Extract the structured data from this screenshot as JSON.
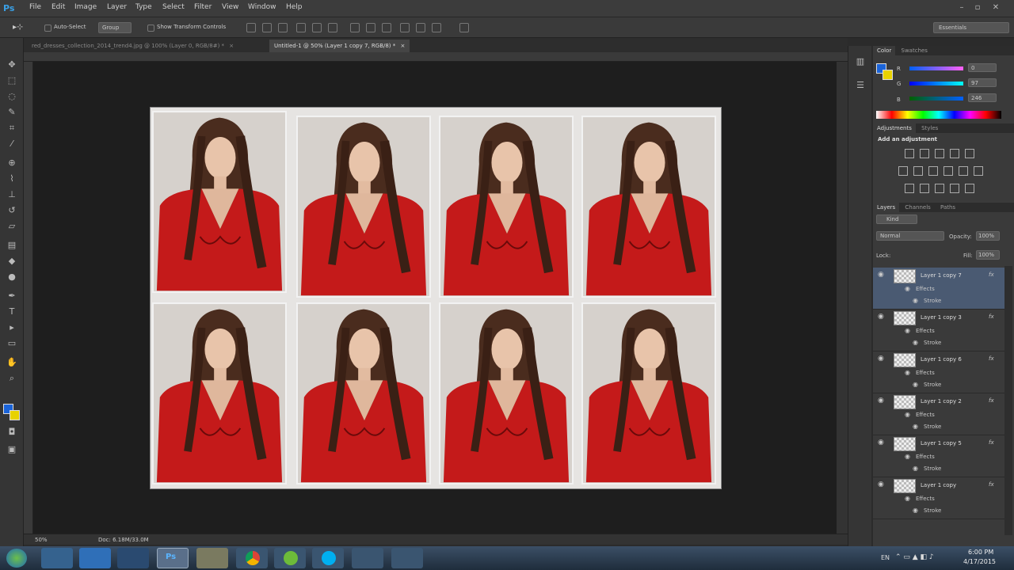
{
  "app": {
    "logo": "Ps"
  },
  "menu": [
    "File",
    "Edit",
    "Image",
    "Layer",
    "Type",
    "Select",
    "Filter",
    "View",
    "Window",
    "Help"
  ],
  "options": {
    "auto_select": "Auto-Select",
    "group": "Group",
    "show_transform": "Show Transform Controls",
    "workspace": "Essentials"
  },
  "tabs": [
    {
      "label": "red_dresses_collection_2014_trend4.jpg @ 100% (Layer 0, RGB/8#) *"
    },
    {
      "label": "Untitled-1 @ 50% (Layer 1 copy 7, RGB/8) *"
    }
  ],
  "status": {
    "zoom": "50%",
    "doc": "Doc: 6.18M/33.0M"
  },
  "color_panel": {
    "tabs": [
      "Color",
      "Swatches"
    ],
    "r": "0",
    "g": "97",
    "b": "246",
    "r_label": "R",
    "g_label": "G",
    "b_label": "B"
  },
  "adjustments": {
    "tabs": [
      "Adjustments",
      "Styles"
    ],
    "title": "Add an adjustment"
  },
  "layers_panel": {
    "tabs": [
      "Layers",
      "Channels",
      "Paths"
    ],
    "kind": "Kind",
    "blend": "Normal",
    "opacity_label": "Opacity:",
    "opacity": "100%",
    "lock_label": "Lock:",
    "fill_label": "Fill:",
    "fill": "100%",
    "layers": [
      {
        "name": "Layer 1 copy 7",
        "effects": "Effects",
        "stroke": "Stroke"
      },
      {
        "name": "Layer 1 copy 3",
        "effects": "Effects",
        "stroke": "Stroke"
      },
      {
        "name": "Layer 1 copy 6",
        "effects": "Effects",
        "stroke": "Stroke"
      },
      {
        "name": "Layer 1 copy 2",
        "effects": "Effects",
        "stroke": "Stroke"
      },
      {
        "name": "Layer 1 copy 5",
        "effects": "Effects",
        "stroke": "Stroke"
      },
      {
        "name": "Layer 1 copy",
        "effects": "Effects",
        "stroke": "Stroke"
      }
    ],
    "fx": "fx"
  },
  "taskbar": {
    "lang": "EN",
    "time": "6:00 PM",
    "date": "4/17/2015"
  },
  "colors": {
    "accent": "#3aa0e6",
    "dress": "#c41a1a"
  }
}
